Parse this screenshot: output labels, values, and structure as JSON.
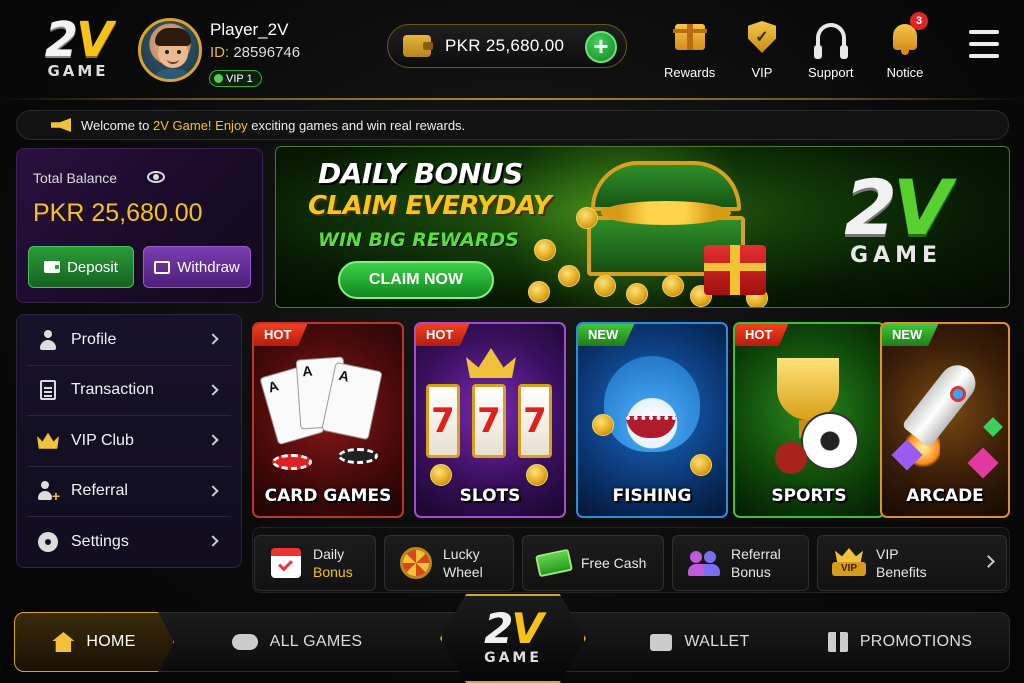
{
  "header": {
    "logo": {
      "two": "2",
      "v": "V",
      "word": "GAME"
    },
    "player": {
      "name": "Player_2V",
      "id_label": "ID:",
      "id_value": "28596746",
      "vip_level": "VIP 1"
    },
    "balance": "PKR 25,680.00",
    "add_funds_label": "+",
    "nav": [
      {
        "label": "Rewards",
        "icon": "gift-icon"
      },
      {
        "label": "VIP",
        "icon": "vip-shield-icon"
      },
      {
        "label": "Support",
        "icon": "headset-icon"
      },
      {
        "label": "Notice",
        "icon": "bell-icon",
        "badge": "3"
      }
    ]
  },
  "ticker": {
    "prefix": "Welcome to ",
    "highlight": "2V Game! Enjoy",
    "suffix": " exciting games and win real rewards."
  },
  "balance_card": {
    "label": "Total Balance",
    "amount": "PKR 25,680.00",
    "deposit_label": "Deposit",
    "withdraw_label": "Withdraw"
  },
  "banner": {
    "line1": "DAILY BONUS",
    "line2": "CLAIM EVERYDAY",
    "line3": "WIN BIG REWARDS",
    "cta": "CLAIM NOW",
    "logo_two": "2",
    "logo_v": "V",
    "logo_word": "GAME"
  },
  "side_menu": [
    {
      "label": "Profile",
      "icon": "user-icon"
    },
    {
      "label": "Transaction",
      "icon": "clipboard-icon"
    },
    {
      "label": "VIP Club",
      "icon": "crown-icon"
    },
    {
      "label": "Referral",
      "icon": "add-user-icon"
    },
    {
      "label": "Settings",
      "icon": "gear-icon"
    }
  ],
  "games": [
    {
      "name": "CARD GAMES",
      "tag": "HOT"
    },
    {
      "name": "SLOTS",
      "tag": "HOT"
    },
    {
      "name": "FISHING",
      "tag": "NEW"
    },
    {
      "name": "SPORTS",
      "tag": "HOT"
    },
    {
      "name": "ARCADE",
      "tag": "NEW"
    }
  ],
  "game_art": {
    "cards": [
      "A",
      "A",
      "A"
    ],
    "reels": [
      "7",
      "7",
      "7"
    ]
  },
  "quick_links": [
    {
      "line1": "Daily",
      "line2": "Bonus",
      "icon": "calendar-icon"
    },
    {
      "line1": "Lucky",
      "line2": "Wheel",
      "icon": "wheel-icon"
    },
    {
      "line1": "Free Cash",
      "line2": "",
      "icon": "cash-icon"
    },
    {
      "line1": "Referral",
      "line2": "Bonus",
      "icon": "people-icon"
    },
    {
      "line1": "VIP",
      "line2": "Benefits",
      "icon": "vip-crown-icon",
      "icon_text": "VIP"
    }
  ],
  "bottom_nav": {
    "home": "HOME",
    "all_games": "ALL GAMES",
    "center_two": "2",
    "center_v": "V",
    "center_word": "GAME",
    "wallet": "WALLET",
    "promotions": "PROMOTIONS"
  },
  "colors": {
    "accent_gold": "#f4c21b",
    "brand_green": "#58d02f",
    "hot_tag": "#e0301a",
    "new_tag": "#3bb532",
    "notice_badge": "#e02525"
  }
}
